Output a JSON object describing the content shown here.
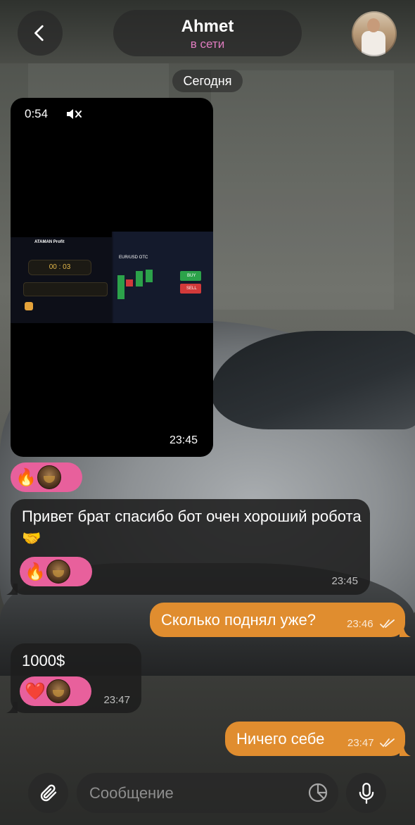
{
  "header": {
    "contact_name": "Ahmet",
    "status": "в сети"
  },
  "date_separator": "Сегодня",
  "messages": [
    {
      "type": "video",
      "direction": "incoming",
      "duration": "0:54",
      "time": "23:45",
      "preview": {
        "app_title": "ATAMAN Profit",
        "timer": "00 : 03",
        "pair": "EUR/USD OTC",
        "buy_label": "BUY",
        "sell_label": "SELL"
      },
      "reaction": "🔥"
    },
    {
      "type": "text",
      "direction": "incoming",
      "text": "Привет брат спасибо бот очен хороший робота 🤝",
      "time": "23:45",
      "reaction": "🔥"
    },
    {
      "type": "text",
      "direction": "outgoing",
      "text": "Сколько поднял уже?",
      "time": "23:46"
    },
    {
      "type": "text",
      "direction": "incoming",
      "text": "1000$",
      "time": "23:47",
      "reaction": "❤️"
    },
    {
      "type": "text",
      "direction": "outgoing",
      "text": "Ничего себе",
      "time": "23:47"
    }
  ],
  "composer": {
    "placeholder": "Сообщение"
  },
  "colors": {
    "accent_status": "#e07cc0",
    "outgoing_bubble": "#e08d2f",
    "reaction_pill": "#e8609c"
  }
}
